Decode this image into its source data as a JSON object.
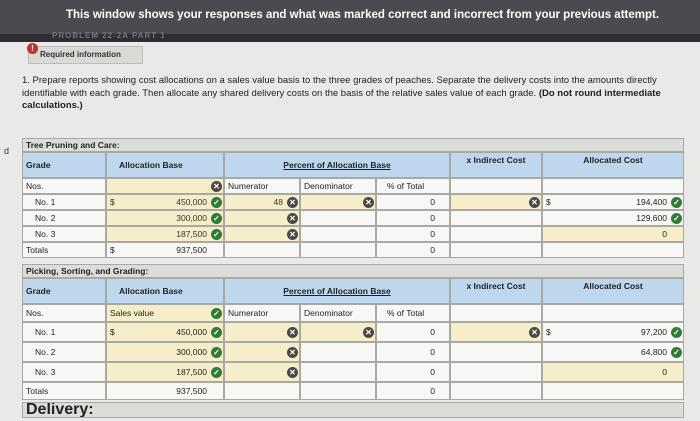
{
  "banner": {
    "text": "This window shows your responses and what was marked correct and incorrect from your previous attempt."
  },
  "required": {
    "label": "Required information",
    "icon": "!"
  },
  "instruction": {
    "text": "1. Prepare reports showing cost allocations on a sales value basis to the three grades of peaches. Separate the delivery costs into the amounts directly identifiable with each grade. Then allocate any shared delivery costs on the basis of the relative sales value of each grade.",
    "bold": "(Do not round intermediate calculations.)"
  },
  "side_label": "d",
  "section1": {
    "title": "Tree Pruning and Care:",
    "headers": {
      "grade": "Grade",
      "alloc_base": "Allocation Base",
      "percent": "Percent of Allocation Base",
      "indirect": "x Indirect Cost",
      "allocated": "Allocated Cost"
    },
    "sub": {
      "numerator": "Numerator",
      "denominator": "Denominator",
      "pct_total": "% of Total"
    },
    "rows": [
      {
        "grade": "Nos.",
        "base": "",
        "num": "",
        "den": "",
        "pct": "",
        "alloc": ""
      },
      {
        "grade": "No. 1",
        "dollar": "$",
        "base": "450,000",
        "num": "48",
        "pct": "0",
        "dollar2": "$",
        "alloc": "194,400"
      },
      {
        "grade": "No. 2",
        "base": "300,000",
        "pct": "0",
        "alloc": "129,600"
      },
      {
        "grade": "No. 3",
        "base": "187,500",
        "pct": "0",
        "alloc": "0"
      },
      {
        "grade": "Totals",
        "dollar": "$",
        "base": "937,500",
        "pct": "0"
      }
    ]
  },
  "section2": {
    "title": "Picking, Sorting, and Grading:",
    "headers": {
      "grade": "Grade",
      "alloc_base": "Allocation Base",
      "percent": "Percent of Allocation Base",
      "indirect": "x Indirect Cost",
      "allocated": "Allocated Cost"
    },
    "sub": {
      "sales_value": "Sales value",
      "numerator": "Numerator",
      "denominator": "Denominator",
      "pct_total": "% of Total"
    },
    "rows": [
      {
        "grade": "Nos."
      },
      {
        "grade": "No. 1",
        "dollar": "$",
        "base": "450,000",
        "pct": "0",
        "dollar2": "$",
        "alloc": "97,200"
      },
      {
        "grade": "No. 2",
        "base": "300,000",
        "pct": "0",
        "alloc": "64,800"
      },
      {
        "grade": "No. 3",
        "base": "187,500",
        "pct": "0",
        "alloc": "0"
      },
      {
        "grade": "Totals",
        "base": "937,500",
        "pct": "0"
      }
    ]
  },
  "section3": {
    "title": "Delivery:"
  },
  "icons": {
    "check": "✓",
    "cross": "✕"
  }
}
